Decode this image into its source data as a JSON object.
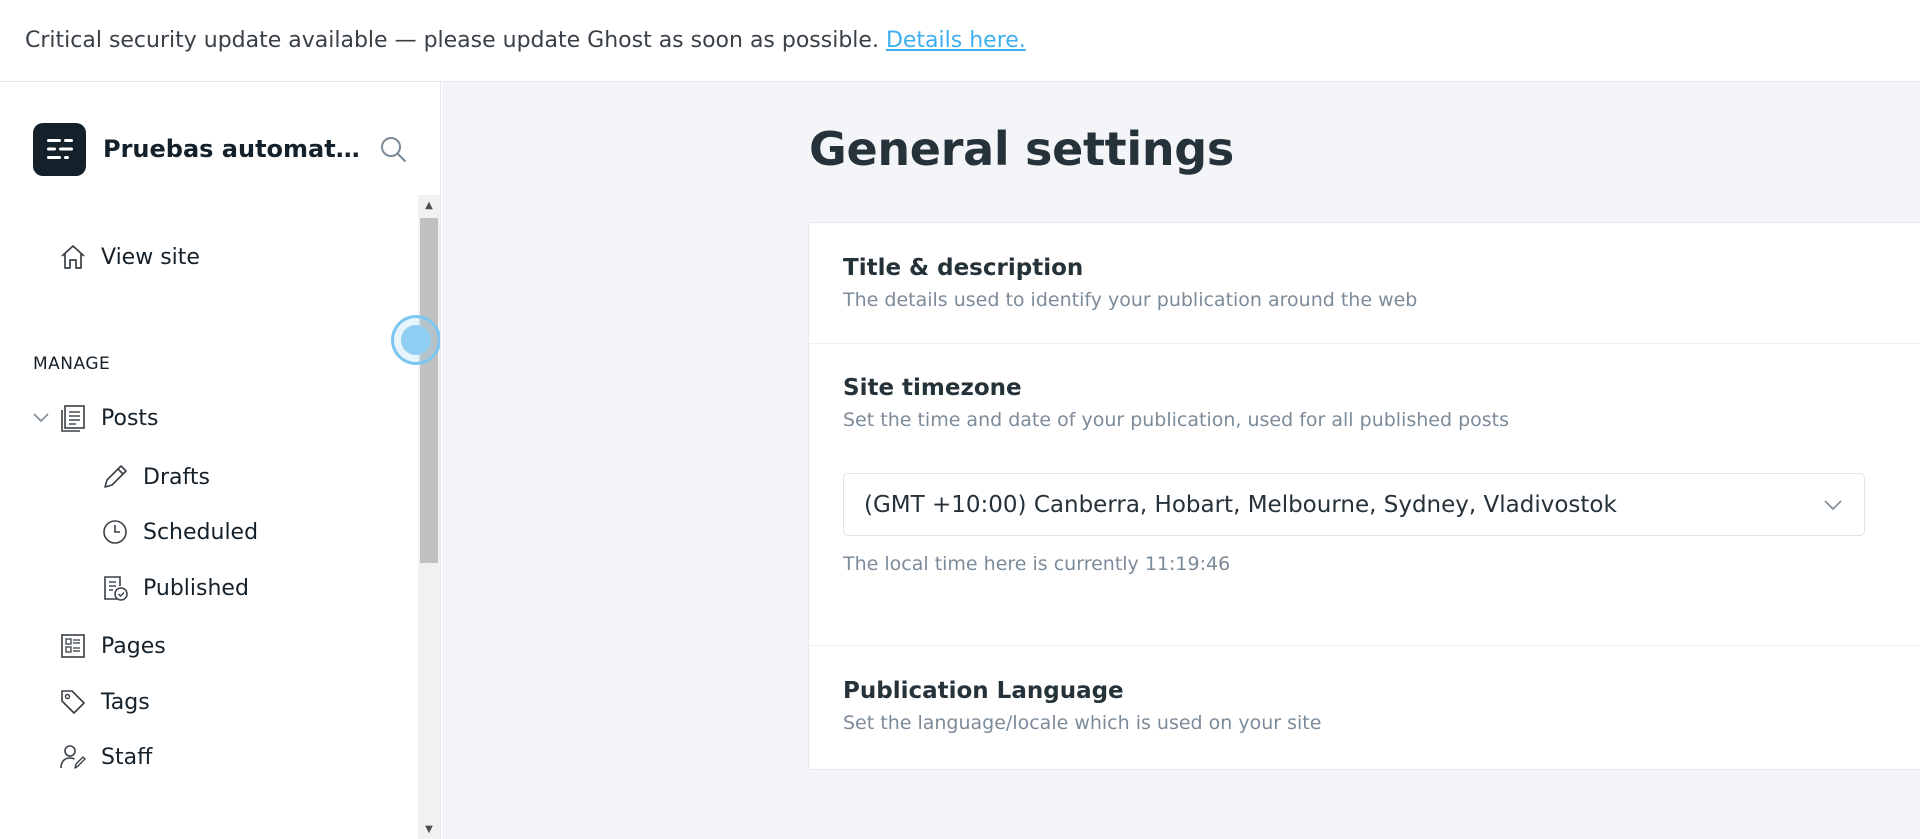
{
  "banner": {
    "message": "Critical security update available — please update Ghost as soon as possible.",
    "link_label": "Details here."
  },
  "sidebar": {
    "brand_name": "Pruebas automatiz...",
    "view_site_label": "View site",
    "manage_label": "MANAGE",
    "posts_label": "Posts",
    "drafts_label": "Drafts",
    "scheduled_label": "Scheduled",
    "published_label": "Published",
    "pages_label": "Pages",
    "tags_label": "Tags",
    "staff_label": "Staff"
  },
  "main": {
    "page_title": "General settings",
    "title_section": {
      "heading": "Title & description",
      "description": "The details used to identify your publication around the web"
    },
    "timezone_section": {
      "heading": "Site timezone",
      "description": "Set the time and date of your publication, used for all published posts",
      "selected_value": "(GMT +10:00) Canberra, Hobart, Melbourne, Sydney, Vladivostok",
      "local_time": "The local time here is currently 11:19:46"
    },
    "language_section": {
      "heading": "Publication Language",
      "description": "Set the language/locale which is used on your site"
    }
  },
  "colors": {
    "link": "#3eb0ef",
    "brand_logo_bg": "#15212a",
    "main_bg": "#f4f5f8"
  }
}
